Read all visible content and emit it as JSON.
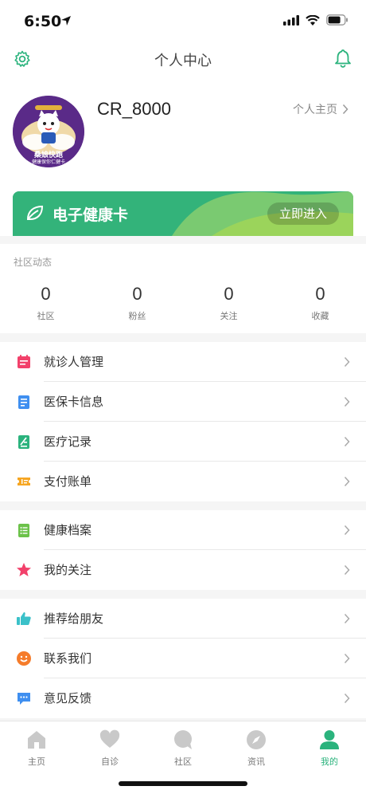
{
  "status": {
    "time": "6:50"
  },
  "nav": {
    "title": "个人中心"
  },
  "profile": {
    "username": "CR_8000",
    "homepage_link": "个人主页",
    "avatar_text_top": "桑娘快跑",
    "avatar_text_bottom": "健康保你仁健卡"
  },
  "health_card": {
    "title": "电子健康卡",
    "button": "立即进入"
  },
  "community": {
    "title": "社区动态",
    "stats": [
      {
        "value": "0",
        "label": "社区"
      },
      {
        "value": "0",
        "label": "粉丝"
      },
      {
        "value": "0",
        "label": "关注"
      },
      {
        "value": "0",
        "label": "收藏"
      }
    ]
  },
  "menu_group_1": [
    {
      "label": "就诊人管理",
      "icon": "calendar-icon"
    },
    {
      "label": "医保卡信息",
      "icon": "document-icon"
    },
    {
      "label": "医疗记录",
      "icon": "record-icon"
    },
    {
      "label": "支付账单",
      "icon": "ticket-icon"
    }
  ],
  "menu_group_2": [
    {
      "label": "健康档案",
      "icon": "list-icon"
    },
    {
      "label": "我的关注",
      "icon": "star-icon"
    }
  ],
  "menu_group_3": [
    {
      "label": "推荐给朋友",
      "icon": "thumbs-up-icon"
    },
    {
      "label": "联系我们",
      "icon": "smile-icon"
    },
    {
      "label": "意见反馈",
      "icon": "chat-icon"
    }
  ],
  "tabs": [
    {
      "label": "主页",
      "icon": "home-icon"
    },
    {
      "label": "自诊",
      "icon": "heart-icon"
    },
    {
      "label": "社区",
      "icon": "bubble-icon"
    },
    {
      "label": "资讯",
      "icon": "compass-icon"
    },
    {
      "label": "我的",
      "icon": "person-icon",
      "active": true
    }
  ],
  "colors": {
    "brand": "#2bb37d",
    "card_green": "#33b37a",
    "card_light": "#9bd45b"
  }
}
